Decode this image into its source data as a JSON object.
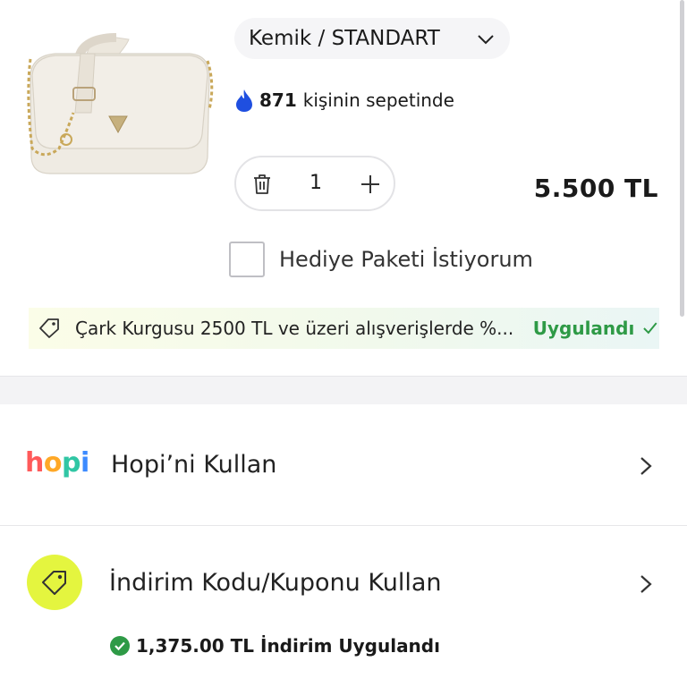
{
  "product": {
    "image_icon": "handbag-image",
    "variant_label": "Kemik / STANDART",
    "basket_count": "871",
    "basket_text": "kişinin sepetinde",
    "quantity": "1",
    "price": "5.500 TL"
  },
  "gift": {
    "label": "Hediye Paketi İstiyorum",
    "checked": false
  },
  "campaign": {
    "text": "Çark Kurgusu 2500 TL ve üzeri alışverişlerde %...",
    "status": "Uygulandı"
  },
  "hopi": {
    "logo": {
      "h": "h",
      "o": "o",
      "p": "p",
      "i": "i"
    },
    "label": "Hopi’ni Kullan"
  },
  "coupon": {
    "label": "İndirim Kodu/Kuponu Kullan",
    "applied_text": "1,375.00 TL İndirim Uygulandı"
  },
  "colors": {
    "accent_green": "#2e9a46",
    "coupon_icon_bg": "#e4f53f",
    "fire_blue": "#1f4fe0"
  }
}
